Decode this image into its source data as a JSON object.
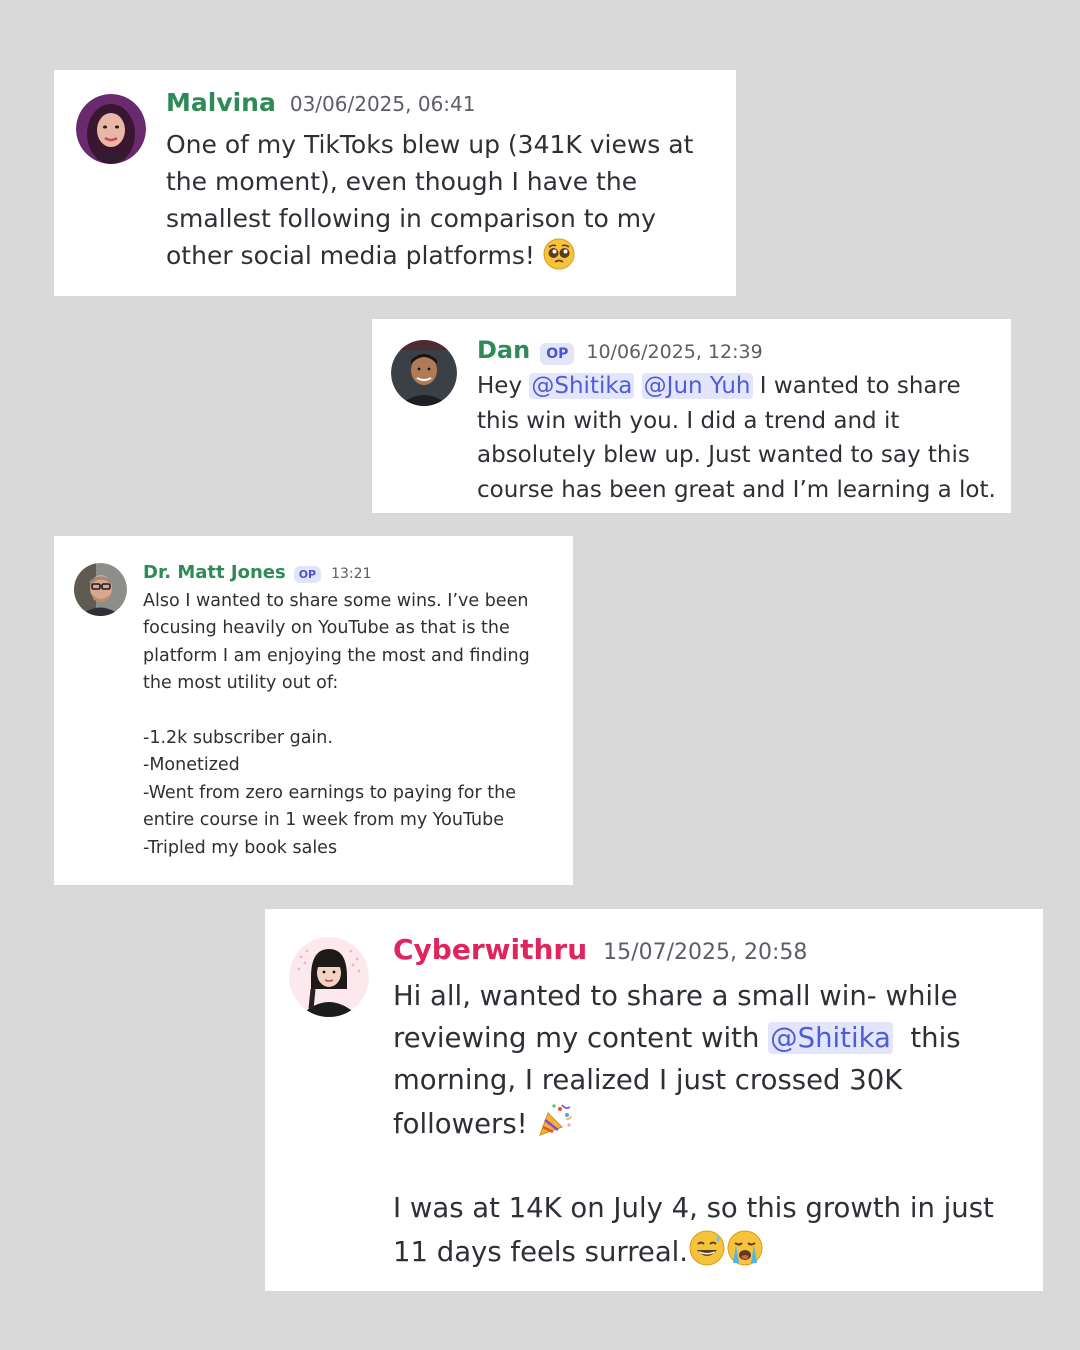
{
  "posts": [
    {
      "author": "Malvina",
      "timestamp": "03/06/2025, 06:41",
      "message": {
        "text": "One of my TikToks blew up (341K views at the moment), even though I have the smallest following in comparison to my other social media platforms!",
        "emoji": [
          "pleading-face"
        ]
      }
    },
    {
      "author": "Dan",
      "badge": "OP",
      "timestamp": "10/06/2025, 12:39",
      "message": {
        "prefix": "Hey ",
        "mentions": [
          "@Shitika",
          "@Jun Yuh"
        ],
        "text": " I wanted to share this win with you. I did a trend and it absolutely blew up. Just wanted to say this course has been great and I’m learning a lot."
      }
    },
    {
      "author": "Dr. Matt Jones",
      "badge": "OP",
      "timestamp": "13:21",
      "message": {
        "intro": "Also I wanted to share some wins. I’ve been focusing heavily on YouTube as that is the platform I am enjoying the most and finding the most utility out of:",
        "items": [
          "-1.2k subscriber gain.",
          "-Monetized",
          "-Went from zero earnings to paying for the entire course in 1 week from my YouTube",
          "-Tripled my book sales"
        ]
      }
    },
    {
      "author": "Cyberwithru",
      "timestamp": "15/07/2025, 20:58",
      "message": {
        "part1": "Hi all, wanted to share a small win- while reviewing my content with ",
        "mention": "@Shitika",
        "part2": "  this morning, I realized I just crossed 30K followers!",
        "part3": "I was at 14K on July 4, so this growth in just 11 days feels surreal.",
        "emoji": [
          "party-popper",
          "sweat-smile-face",
          "loudly-crying-face"
        ]
      }
    }
  ],
  "colors": {
    "background": "#d9d9d9",
    "card": "#ffffff",
    "name_green": "#2e8b57",
    "name_pink": "#e0245e",
    "mention_text": "#4f5cd6",
    "mention_bg": "#e3e6fb"
  }
}
